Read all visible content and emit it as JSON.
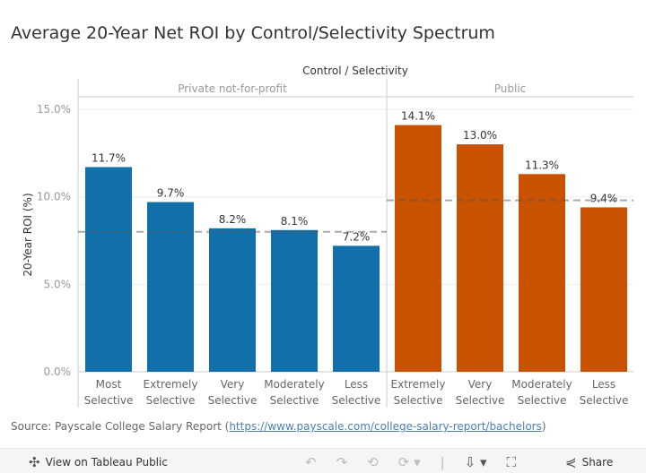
{
  "title": "Average 20-Year Net ROI by Control/Selectivity Spectrum",
  "source": {
    "prefix": "Source: Payscale College Salary Report (",
    "link": "https://www.payscale.com/college-salary-report/bachelors",
    "suffix": ")"
  },
  "toolbar": {
    "view_label": "View on Tableau Public",
    "share_label": "Share"
  },
  "chart_data": {
    "type": "bar",
    "column_header": "Control / Selectivity",
    "ylabel": "20-Year ROI (%)",
    "ylim": [
      0,
      16.5
    ],
    "yticks": [
      "0.0%",
      "5.0%",
      "10.0%",
      "15.0%"
    ],
    "ytick_values": [
      0,
      5,
      10,
      15
    ],
    "grid": true,
    "panels": [
      {
        "name": "Private not-for-profit",
        "color": "#1170aa",
        "average": 8.0,
        "categories": [
          [
            "Most",
            "Selective"
          ],
          [
            "Extremely",
            "Selective"
          ],
          [
            "Very",
            "Selective"
          ],
          [
            "Moderately",
            "Selective"
          ],
          [
            "Less",
            "Selective"
          ]
        ],
        "values": [
          11.7,
          9.7,
          8.2,
          8.1,
          7.2
        ],
        "labels": [
          "11.7%",
          "9.7%",
          "8.2%",
          "8.1%",
          "7.2%"
        ]
      },
      {
        "name": "Public",
        "color": "#c85200",
        "average": 9.8,
        "categories": [
          [
            "Extremely",
            "Selective"
          ],
          [
            "Very",
            "Selective"
          ],
          [
            "Moderately",
            "Selective"
          ],
          [
            "Less",
            "Selective"
          ]
        ],
        "values": [
          14.1,
          13.0,
          11.3,
          9.4
        ],
        "labels": [
          "14.1%",
          "13.0%",
          "11.3%",
          "9.4%"
        ]
      }
    ]
  }
}
